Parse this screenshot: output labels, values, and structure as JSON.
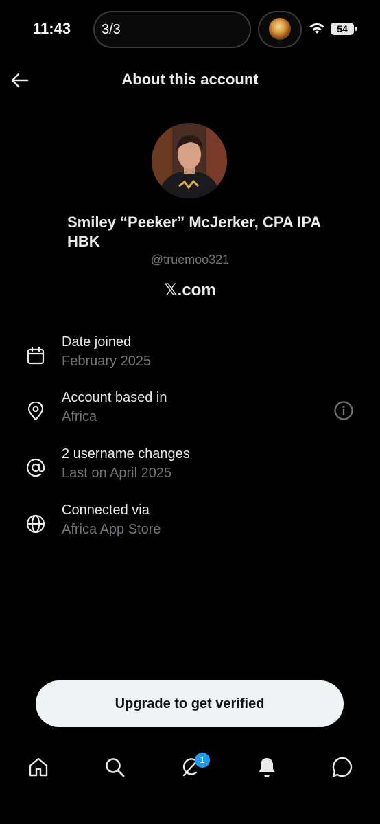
{
  "status_bar": {
    "time": "11:43",
    "page_indicator": "3/3",
    "battery": "54"
  },
  "header": {
    "title": "About this account",
    "back_icon": "arrow-left-icon"
  },
  "profile": {
    "display_name": "Smiley “Peeker” McJerker, CPA IPA HBK",
    "handle": "@truemoo321",
    "site": "𝕏.com"
  },
  "details": [
    {
      "icon": "calendar-icon",
      "label": "Date joined",
      "value": "February 2025"
    },
    {
      "icon": "location-pin-icon",
      "label": "Account based in",
      "value": "Africa"
    },
    {
      "icon": "at-sign-icon",
      "label": "2 username changes",
      "value": "Last on April 2025"
    },
    {
      "icon": "globe-icon",
      "label": "Connected via",
      "value": "Africa App Store"
    }
  ],
  "cta": {
    "label": "Upgrade to get verified"
  },
  "nav": {
    "items": [
      "home-icon",
      "search-icon",
      "grok-icon",
      "notifications-icon",
      "messages-icon"
    ],
    "grok_badge": "1"
  },
  "colors": {
    "background": "#000000",
    "text": "#e7e9ea",
    "muted": "#71767b",
    "accent": "#1d9bf0",
    "button": "#eff3f4"
  }
}
